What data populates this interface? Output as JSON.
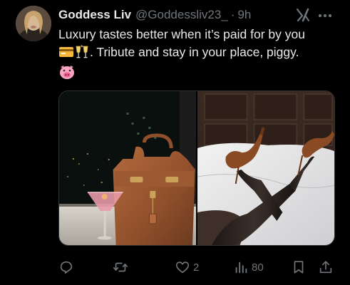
{
  "tweet": {
    "author": {
      "display_name": "Goddess Liv",
      "handle": "@Goddessliv23_",
      "separator": "·",
      "time": "9h"
    },
    "text": {
      "line1": "Luxury tastes better when it’s paid for by you",
      "line2_emojis": [
        "credit-card-emoji",
        "clinking-glasses-emoji"
      ],
      "line2_text": ". Tribute and stay in your place, piggy.",
      "line3_emojis": [
        "pig-face-emoji"
      ]
    },
    "media": {
      "count": 2,
      "photos": [
        "photo-handbag-and-cocktail",
        "photo-legs-in-heels"
      ]
    },
    "actions": {
      "reply": {
        "icon": "reply-icon",
        "count": ""
      },
      "retweet": {
        "icon": "retweet-icon",
        "count": ""
      },
      "like": {
        "icon": "heart-icon",
        "count": "2"
      },
      "views": {
        "icon": "views-icon",
        "count": "80"
      },
      "bookmark": {
        "icon": "bookmark-icon",
        "count": ""
      },
      "share": {
        "icon": "share-icon",
        "count": ""
      }
    },
    "icons": {
      "grok": "grok-icon",
      "more": "more-icon"
    }
  },
  "colors": {
    "background": "#000000",
    "text_primary": "#e7e9ea",
    "text_secondary": "#71767b",
    "border": "#2f3336"
  }
}
